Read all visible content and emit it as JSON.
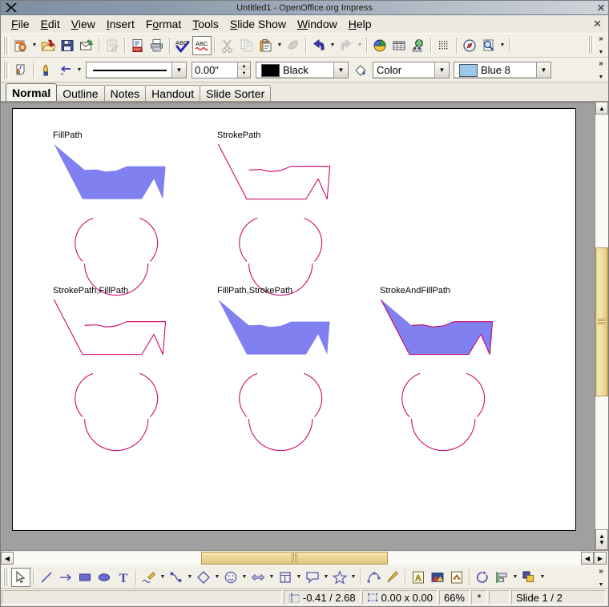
{
  "window": {
    "title": "Untitled1 - OpenOffice.org Impress",
    "logo": "X",
    "close_glyph": "✕"
  },
  "menubar": {
    "close_glyph": "✕",
    "items": [
      {
        "label": "File",
        "accel": "F"
      },
      {
        "label": "Edit",
        "accel": "E"
      },
      {
        "label": "View",
        "accel": "V"
      },
      {
        "label": "Insert",
        "accel": "I"
      },
      {
        "label": "Format",
        "accel": "o"
      },
      {
        "label": "Tools",
        "accel": "T"
      },
      {
        "label": "Slide Show",
        "accel": "S"
      },
      {
        "label": "Window",
        "accel": "W"
      },
      {
        "label": "Help",
        "accel": "H"
      }
    ]
  },
  "standard_toolbar": {
    "overflow_label": "»",
    "items": [
      {
        "name": "new-document-button",
        "icon": "new-doc-icon",
        "dropdown": true
      },
      {
        "name": "open-button",
        "icon": "open-folder-icon"
      },
      {
        "name": "save-button",
        "icon": "floppy-save-icon"
      },
      {
        "name": "email-button",
        "icon": "envelope-icon"
      },
      {
        "name": "edit-file-button",
        "icon": "edit-file-icon",
        "disabled": true
      },
      {
        "name": "export-pdf-button",
        "icon": "pdf-icon"
      },
      {
        "name": "print-button",
        "icon": "printer-icon"
      },
      {
        "name": "spelling-button",
        "icon": "abc-check-icon"
      },
      {
        "name": "autospellcheck-button",
        "icon": "abc-wave-icon",
        "pressed": true
      },
      {
        "name": "cut-button",
        "icon": "scissors-icon",
        "disabled": true
      },
      {
        "name": "copy-button",
        "icon": "copy-pages-icon",
        "disabled": true
      },
      {
        "name": "paste-button",
        "icon": "clipboard-icon",
        "dropdown": true
      },
      {
        "name": "clone-formatting-button",
        "icon": "paintbrush-icon",
        "disabled": true
      },
      {
        "name": "undo-button",
        "icon": "undo-arrow-icon",
        "dropdown": true
      },
      {
        "name": "redo-button",
        "icon": "redo-arrow-icon",
        "dropdown": true,
        "disabled": true
      },
      {
        "name": "insert-chart-button",
        "icon": "pie-chart-icon"
      },
      {
        "name": "insert-table-button",
        "icon": "table-grid-icon"
      },
      {
        "name": "insert-image-button",
        "icon": "globe-image-icon"
      },
      {
        "name": "display-grid-button",
        "icon": "grid-dots-icon"
      },
      {
        "name": "navigator-button",
        "icon": "compass-icon"
      },
      {
        "name": "zoom-button",
        "icon": "magnifier-page-icon",
        "dropdown": true
      }
    ]
  },
  "line_fill_toolbar": {
    "overflow_label": "»",
    "select_button": "select-tool-icon",
    "line_style_edit_button": "line-pen-icon",
    "arrow_style_button": "arrow-style-icon",
    "line_style_value": "──────────",
    "line_width_value": "0.00\"",
    "line_color_value": "Black",
    "line_color_hex": "#000000",
    "area_style_button": "paint-can-icon",
    "fill_style_value": "Color",
    "fill_color_value": "Blue 8",
    "fill_color_hex": "#9bc8ee"
  },
  "view_tabs": [
    {
      "label": "Normal",
      "active": true
    },
    {
      "label": "Outline",
      "active": false
    },
    {
      "label": "Notes",
      "active": false
    },
    {
      "label": "Handout",
      "active": false
    },
    {
      "label": "Slide Sorter",
      "active": false
    }
  ],
  "slide": {
    "background": "#ffffff",
    "stroke_color": "#cc0066",
    "fill_color": "#8080f0",
    "shapes": [
      {
        "label": "FillPath",
        "mode": "fill"
      },
      {
        "label": "StrokePath",
        "mode": "stroke"
      },
      {
        "label": "StrokePath,FillPath",
        "mode": "stroke"
      },
      {
        "label": "FillPath,StrokePath",
        "mode": "fill"
      },
      {
        "label": "StrokeAndFillPath",
        "mode": "both"
      }
    ]
  },
  "drawing_toolbar": {
    "overflow_label": "»",
    "items": [
      {
        "name": "select-tool-button",
        "icon": "cursor-arrow-icon",
        "pressed": true
      },
      {
        "name": "line-tool-button",
        "icon": "line-icon"
      },
      {
        "name": "arrow-tool-button",
        "icon": "arrow-icon"
      },
      {
        "name": "rectangle-tool-button",
        "icon": "rectangle-icon"
      },
      {
        "name": "ellipse-tool-button",
        "icon": "ellipse-icon"
      },
      {
        "name": "text-tool-button",
        "icon": "text-t-icon"
      },
      {
        "name": "curve-tool-button",
        "icon": "curve-pencil-icon",
        "dropdown": true
      },
      {
        "name": "connector-tool-button",
        "icon": "connector-icon",
        "dropdown": true
      },
      {
        "name": "basic-shapes-button",
        "icon": "diamond-icon",
        "dropdown": true
      },
      {
        "name": "symbol-shapes-button",
        "icon": "smiley-icon",
        "dropdown": true
      },
      {
        "name": "block-arrows-button",
        "icon": "block-arrow-icon",
        "dropdown": true
      },
      {
        "name": "flowchart-shapes-button",
        "icon": "flowchart-icon",
        "dropdown": true
      },
      {
        "name": "callout-shapes-button",
        "icon": "callout-icon",
        "dropdown": true
      },
      {
        "name": "stars-shapes-button",
        "icon": "star-icon",
        "dropdown": true
      },
      {
        "name": "points-button",
        "icon": "edit-points-icon"
      },
      {
        "name": "glue-points-button",
        "icon": "glue-points-pen-icon"
      },
      {
        "name": "fontwork-button",
        "icon": "fontwork-a-icon"
      },
      {
        "name": "insert-picture-button",
        "icon": "picture-icon"
      },
      {
        "name": "insert-gallery-button",
        "icon": "gallery-house-icon"
      },
      {
        "name": "rotate-button",
        "icon": "rotate-icon"
      },
      {
        "name": "alignment-button",
        "icon": "align-icon",
        "dropdown": true
      },
      {
        "name": "arrange-button",
        "icon": "arrange-icon",
        "dropdown": true
      }
    ]
  },
  "statusbar": {
    "left_text": "",
    "cursor_position": "-0.41 / 2.68",
    "object_size": "0.00 x 0.00",
    "zoom": "66%",
    "modified": "*",
    "signature": "",
    "slide_info": "Slide 1 / 2",
    "position_icon": "crosshair-icon",
    "size_icon": "selection-box-icon"
  }
}
